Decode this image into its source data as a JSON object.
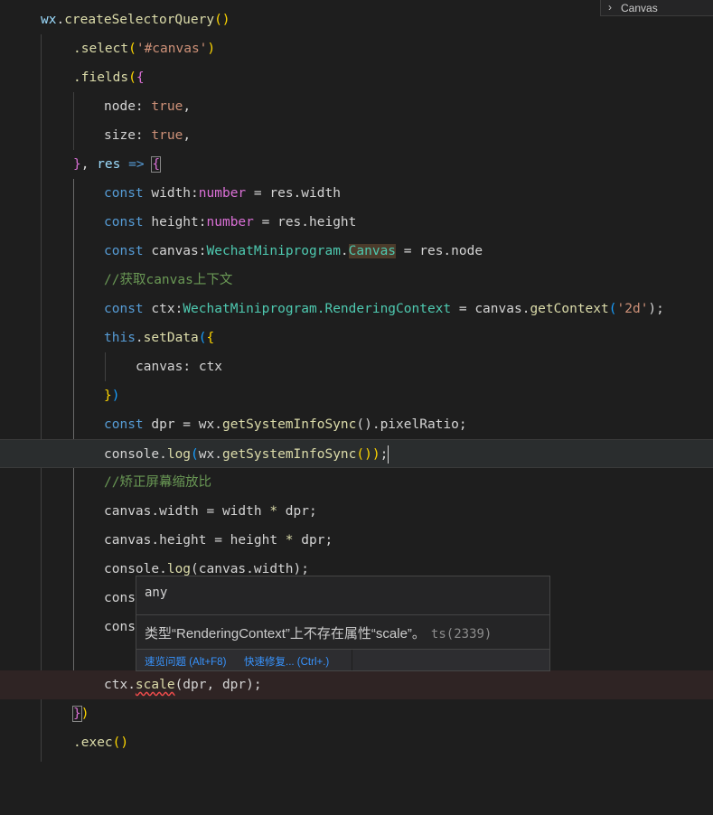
{
  "breadcrumb": {
    "chevron_icon": "chevron-right-icon",
    "label": "Canvas"
  },
  "code": {
    "l1_obj": "wx",
    "l1_dot": ".",
    "l1_fn": "createSelectorQuery",
    "l1_paren": "()",
    "l2_fn": ".select",
    "l2_open": "(",
    "l2_str": "'#canvas'",
    "l2_close": ")",
    "l3_fn": ".fields",
    "l3_open": "(",
    "l3_brace": "{",
    "l4_key": "node: ",
    "l4_val": "true",
    "l4_comma": ",",
    "l5_key": "size: ",
    "l5_val": "true",
    "l5_comma": ",",
    "l6_brace": "}",
    "l6_comma": ", ",
    "l6_param": "res",
    "l6_arrow": " => ",
    "l6_open": "{",
    "l7_kw": "const ",
    "l7_var": "width",
    "l7_colon": ":",
    "l7_type": "number",
    "l7_rest": " = res.width",
    "l8_kw": "const ",
    "l8_var": "height",
    "l8_colon": ":",
    "l8_type": "number",
    "l8_rest": " = res.height",
    "l9_kw": "const ",
    "l9_var": "canvas",
    "l9_colon": ":",
    "l9_type": "WechatMiniprogram",
    "l9_dot": ".",
    "l9_type2": "Canvas",
    "l9_rest": " = res.node",
    "l10_comment": "//获取canvas上下文",
    "l11_kw": "const ",
    "l11_var": "ctx",
    "l11_colon": ":",
    "l11_type": "WechatMiniprogram.RenderingContext",
    "l11_eq": " = canvas.",
    "l11_fn": "getContext",
    "l11_open": "(",
    "l11_str": "'2d'",
    "l11_close": ");",
    "l12_kw": "this",
    "l12_dot": ".",
    "l12_fn": "setData",
    "l12_open": "(",
    "l12_brace": "{",
    "l13_text": "canvas: ctx",
    "l14_brace": "}",
    "l14_close": ")",
    "l15_kw": "const ",
    "l15_var": "dpr = wx.",
    "l15_fn": "getSystemInfoSync",
    "l15_rest": "().pixelRatio;",
    "l16_obj": "console.",
    "l16_fn": "log",
    "l16_open": "(",
    "l16_mid": "wx.",
    "l16_fn2": "getSystemInfoSync",
    "l16_close": "())",
    "l16_semi": ";",
    "l17_comment": "//矫正屏幕缩放比",
    "l18_a": "canvas.width = width ",
    "l18_op": "*",
    "l18_b": " dpr;",
    "l19_a": "canvas.height = height ",
    "l19_op": "*",
    "l19_b": " dpr;",
    "l20_obj": "console.",
    "l20_fn": "log",
    "l20_rest": "(canvas.width);",
    "l21_text": "cons",
    "l22_text": "cons",
    "l24_obj": "ctx.",
    "l24_fn": "scale",
    "l24_rest": "(dpr, dpr);",
    "l25_brace": "}",
    "l25_close": ")",
    "l26_fn": ".exec",
    "l26_paren": "()"
  },
  "hover": {
    "signature": "any",
    "message": "类型“RenderingContext”上不存在属性“scale”。",
    "error_code": "ts(2339)",
    "action_peek": "速览问题 (Alt+F8)",
    "action_fix": "快速修复... (Ctrl+.)"
  }
}
